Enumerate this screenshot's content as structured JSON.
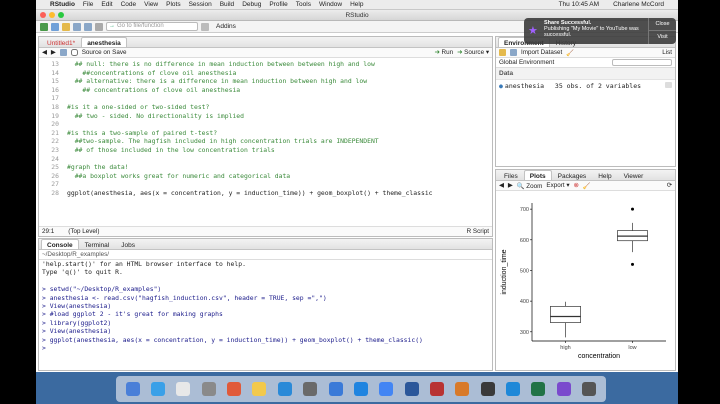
{
  "mac_menu": {
    "app_name": "RStudio",
    "items": [
      "File",
      "Edit",
      "Code",
      "View",
      "Plots",
      "Session",
      "Build",
      "Debug",
      "Profile",
      "Tools",
      "Window",
      "Help"
    ],
    "datetime": "Thu 10:45 AM",
    "user": "Charlene McCord"
  },
  "window": {
    "title": "RStudio"
  },
  "toolbar": {
    "goto_placeholder": "Go to file/function",
    "addins": "Addins"
  },
  "notification": {
    "title": "Share Successful.",
    "body": "Publishing \"My Movie\" to YouTube was successful.",
    "close": "Close",
    "visit": "Visit"
  },
  "editor": {
    "tabs": [
      "Untitled1*",
      "anesthesia"
    ],
    "source_on_save": "Source on Save",
    "run": "Run",
    "source": "Source",
    "lines": [
      {
        "n": "13",
        "text": "  ## null: there is no difference in mean induction between between high and low",
        "comment": true
      },
      {
        "n": "14",
        "text": "    ##concentrations of clove oil anesthesia",
        "comment": true
      },
      {
        "n": "15",
        "text": "  ## alternative: there is a difference in mean induction between high and low",
        "comment": true
      },
      {
        "n": "16",
        "text": "    ## concentrations of clove oil anesthesia",
        "comment": true
      },
      {
        "n": "17",
        "text": "",
        "comment": false
      },
      {
        "n": "18",
        "text": "#is it a one-sided or two-sided test?",
        "comment": true
      },
      {
        "n": "19",
        "text": "  ## two - sided. No directionality is implied",
        "comment": true
      },
      {
        "n": "20",
        "text": "",
        "comment": false
      },
      {
        "n": "21",
        "text": "#is this a two-sample of paired t-test?",
        "comment": true
      },
      {
        "n": "22",
        "text": "  ##two-sample. The hagfish included in high concentration trials are INDEPENDENT",
        "comment": true
      },
      {
        "n": "23",
        "text": "  ## of those included in the low concentration trials",
        "comment": true
      },
      {
        "n": "24",
        "text": "",
        "comment": false
      },
      {
        "n": "25",
        "text": "#graph the data!",
        "comment": true
      },
      {
        "n": "26",
        "text": "  ##a boxplot works great for numeric and categorical data",
        "comment": true
      },
      {
        "n": "27",
        "text": "",
        "comment": false
      },
      {
        "n": "28",
        "text": "ggplot(anesthesia, aes(x = concentration, y = induction_time)) + geom_boxplot() + theme_classic",
        "comment": false
      }
    ],
    "status_pos": "29:1",
    "status_level": "(Top Level)",
    "status_type": "R Script"
  },
  "console": {
    "tabs": [
      "Console",
      "Terminal",
      "Jobs"
    ],
    "path": "~/Desktop/R_examples/",
    "lines": [
      {
        "text": "'help.start()' for an HTML browser interface to help.",
        "out": true
      },
      {
        "text": "Type 'q()' to quit R.",
        "out": true
      },
      {
        "text": "",
        "out": true
      },
      {
        "text": "> setwd(\"~/Desktop/R_examples\")",
        "out": false
      },
      {
        "text": "> anesthesia <- read.csv(\"hagfish_induction.csv\", header = TRUE, sep =\",\")",
        "out": false
      },
      {
        "text": "> View(anesthesia)",
        "out": false
      },
      {
        "text": "> #load ggplot 2 - it's great for making graphs",
        "out": false
      },
      {
        "text": "> library(ggplot2)",
        "out": false
      },
      {
        "text": "> View(anesthesia)",
        "out": false
      },
      {
        "text": "> ggplot(anesthesia, aes(x = concentration, y = induction_time)) + geom_boxplot() + theme_classic()",
        "out": false
      },
      {
        "text": ">",
        "out": false
      }
    ]
  },
  "environment": {
    "tabs": [
      "Environment",
      "History"
    ],
    "import_dataset": "Import Dataset",
    "list_label": "List",
    "global_env": "Global Environment",
    "section": "Data",
    "row_name": "anesthesia",
    "row_value": "35 obs. of 2 variables"
  },
  "files": {
    "tabs": [
      "Files",
      "Plots",
      "Packages",
      "Help",
      "Viewer"
    ],
    "zoom": "Zoom",
    "export": "Export"
  },
  "chart_data": {
    "type": "box",
    "categories": [
      "high",
      "low"
    ],
    "xlabel": "concentration",
    "ylabel": "induction_time",
    "yticks": [
      300,
      400,
      500,
      600,
      700
    ],
    "ylim": [
      270,
      720
    ],
    "boxes": [
      {
        "name": "high",
        "whisker_low": 282,
        "q1": 330,
        "median": 350,
        "q3": 383,
        "whisker_high": 398,
        "outliers": []
      },
      {
        "name": "low",
        "whisker_low": 560,
        "q1": 597,
        "median": 612,
        "q3": 630,
        "whisker_high": 655,
        "outliers": [
          700,
          520
        ]
      }
    ]
  }
}
